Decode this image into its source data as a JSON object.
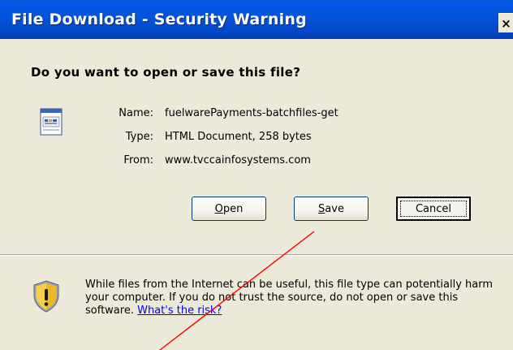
{
  "window": {
    "title": "File Download - Security Warning",
    "close_glyph": "×"
  },
  "prompt": {
    "question": "Do you want to open or save this file?"
  },
  "file_info": {
    "icon": "html-document-icon",
    "name_label": "Name:",
    "name_value": "fuelwarePayments-batchfiles-get",
    "type_label": "Type:",
    "type_value": "HTML Document, 258 bytes",
    "from_label": "From:",
    "from_value": "www.tvccainfosystems.com"
  },
  "buttons": {
    "open": {
      "mnemonic": "O",
      "rest": "pen"
    },
    "save": {
      "mnemonic": "S",
      "rest": "ave"
    },
    "cancel": "Cancel"
  },
  "warning": {
    "icon": "shield-warning-icon",
    "text": "While files from the Internet can be useful, this file type can potentially harm your computer. If you do not trust the source, do not open or save this software. ",
    "risk_link": "What's the risk?"
  },
  "colors": {
    "titlebar": "#0453db",
    "dialog_bg": "#ece9d8",
    "link": "#0000ff",
    "annotation_line": "#ff0000"
  }
}
